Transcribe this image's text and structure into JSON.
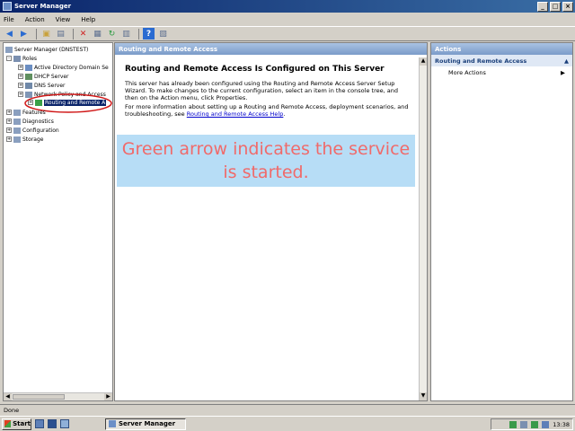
{
  "window": {
    "title": "Server Manager",
    "min": "_",
    "max": "□",
    "close": "×"
  },
  "menu": [
    "File",
    "Action",
    "View",
    "Help"
  ],
  "tree": {
    "items": [
      {
        "label": "Server Manager (DNSTEST)",
        "exp": ""
      },
      {
        "label": "Roles",
        "exp": "-"
      },
      {
        "label": "Active Directory Domain Se",
        "exp": "+"
      },
      {
        "label": "DHCP Server",
        "exp": "+"
      },
      {
        "label": "DNS Server",
        "exp": "+"
      },
      {
        "label": "Network Policy and Access",
        "exp": "+"
      },
      {
        "label": "Routing and Remote A",
        "exp": "+"
      },
      {
        "label": "Features",
        "exp": "+"
      },
      {
        "label": "Diagnostics",
        "exp": "+"
      },
      {
        "label": "Configuration",
        "exp": "+"
      },
      {
        "label": "Storage",
        "exp": "+"
      }
    ]
  },
  "main": {
    "header": "Routing and Remote Access",
    "heading": "Routing and Remote Access Is Configured on This Server",
    "para1": "This server has already been configured using the Routing and Remote Access Server Setup Wizard. To make changes to the current configuration, select an item in the console tree, and then on the Action menu, click Properties.",
    "para2_text": "For more information about setting up a Routing and Remote Access, deployment scenarios, and troubleshooting, see",
    "para2_link": "Routing and Remote Access Help",
    "overlay": "Green arrow indicates the service is started."
  },
  "actions": {
    "header": "Actions",
    "section": "Routing and Remote Access",
    "item": "More Actions"
  },
  "status": "Done",
  "taskbar": {
    "start": "Start",
    "task": "Server Manager",
    "clock": "13:38"
  },
  "colors": {
    "titlebar": "#0a246a",
    "pane_header": "#7b9bc9",
    "overlay_text": "#f06a6a",
    "overlay_bg": "#aad7f5",
    "selection": "#0a246a"
  }
}
